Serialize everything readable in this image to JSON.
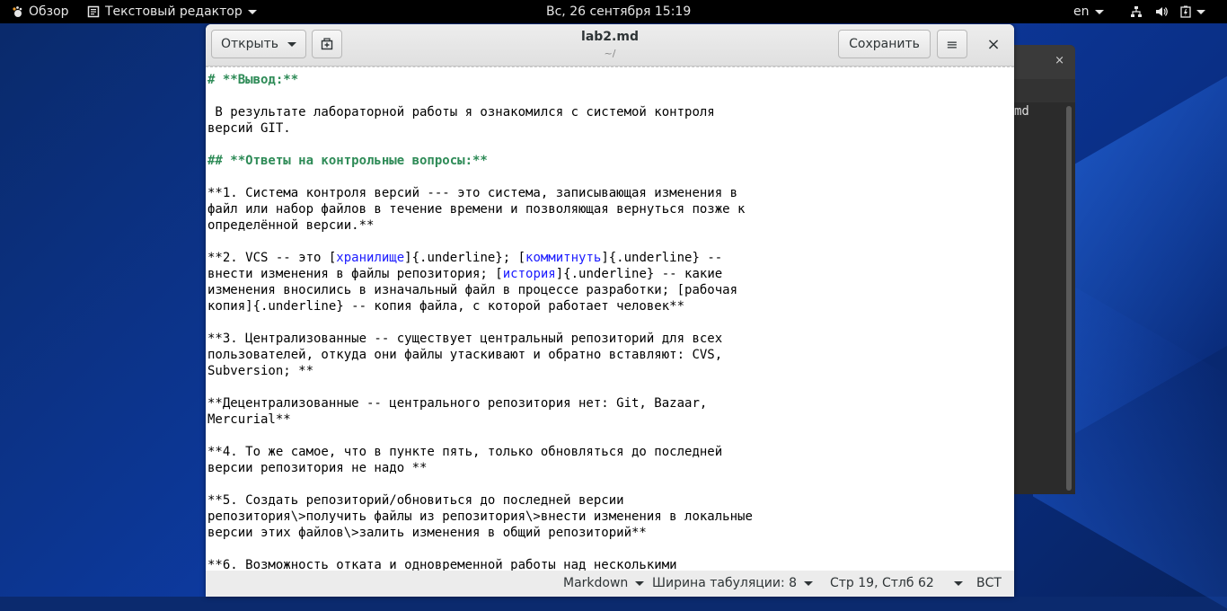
{
  "topbar": {
    "activities": "Обзор",
    "app_menu": "Текстовый редактор",
    "clock": "Вс, 26 сентября  15:19",
    "lang": "en"
  },
  "bg_window": {
    "close": "×",
    "text": "md"
  },
  "header": {
    "open_label": "Открыть",
    "title": "lab2.md",
    "subtitle": "~/",
    "save_label": "Сохранить",
    "menu_icon": "≡",
    "close_icon": "×"
  },
  "editor": {
    "lines": [
      [
        {
          "t": "# **Вывод:**",
          "c": "hd"
        }
      ],
      [],
      [
        {
          "t": " В результате лабораторной работы я ознакомился с системой контроля"
        }
      ],
      [
        {
          "t": "версий GIT."
        }
      ],
      [],
      [
        {
          "t": "## **Ответы на контрольные вопросы:**",
          "c": "hd"
        }
      ],
      [],
      [
        {
          "t": "**1. Система контроля версий --- это система, записывающая изменения в"
        }
      ],
      [
        {
          "t": "файл или набор файлов в течение времени и позволяющая вернуться позже к"
        }
      ],
      [
        {
          "t": "определённой версии.**"
        }
      ],
      [],
      [
        {
          "t": "**2. VCS -- это ["
        },
        {
          "t": "хранилище",
          "c": "lk"
        },
        {
          "t": "]{.underline}; ["
        },
        {
          "t": "коммитнуть",
          "c": "lk"
        },
        {
          "t": "]{.underline} --"
        }
      ],
      [
        {
          "t": "внести изменения в файлы репозитория; ["
        },
        {
          "t": "история",
          "c": "lk"
        },
        {
          "t": "]{.underline} -- какие"
        }
      ],
      [
        {
          "t": "изменения вносились в изначальный файл в процессе разработки; [рабочая"
        }
      ],
      [
        {
          "t": "копия]{.underline} -- копия файла, с которой работает человек**"
        }
      ],
      [],
      [
        {
          "t": "**3. Централизованные -- существует центральный репозиторий для всех"
        }
      ],
      [
        {
          "t": "пользователей, откуда они файлы утаскивают и обратно вставляют: CVS,"
        }
      ],
      [
        {
          "t": "Subversion; **"
        }
      ],
      [],
      [
        {
          "t": "**Децентрализованные -- центрального репозитория нет: Git, Bazaar,"
        }
      ],
      [
        {
          "t": "Mercurial**"
        }
      ],
      [],
      [
        {
          "t": "**4. То же самое, что в пункте пять, только обновляться до последней"
        }
      ],
      [
        {
          "t": "версии репозитория не надо **"
        }
      ],
      [],
      [
        {
          "t": "**5. Создать репозиторий/обновиться до последней версии"
        }
      ],
      [
        {
          "t": "репозитория\\>получить файлы из репозитория\\>внести изменения в локальные"
        }
      ],
      [
        {
          "t": "версии этих файлов\\>залить изменения в общий репозиторий**"
        }
      ],
      [],
      [
        {
          "t": "**6. Возможность отката и одновременной работы над несколькими"
        }
      ]
    ]
  },
  "statusbar": {
    "language": "Markdown",
    "tab_width": "Ширина табуляции: 8",
    "position": "Стр 19, Стлб 62",
    "mode": "ВСТ"
  }
}
